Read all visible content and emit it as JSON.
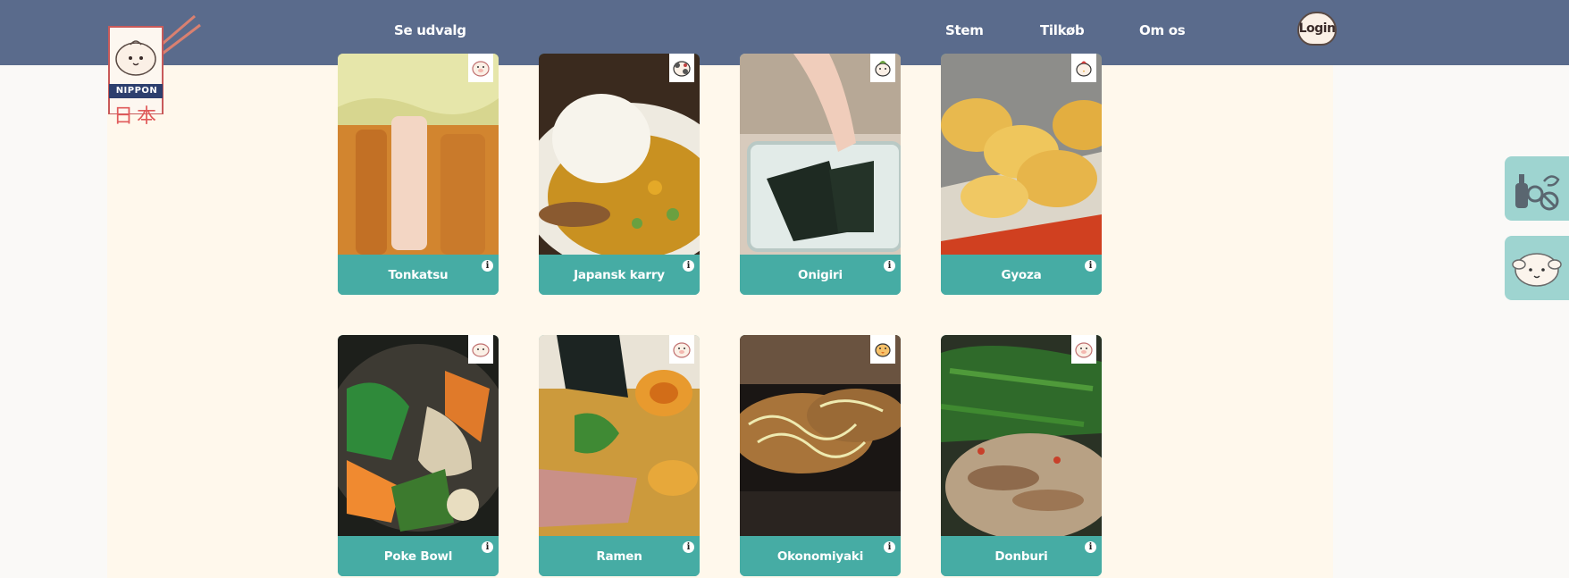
{
  "brand": {
    "logo_text": "NIPPON",
    "logo_kanji": "日本"
  },
  "nav": {
    "items": [
      {
        "label": "Se udvalg"
      },
      {
        "label": "Stem"
      },
      {
        "label": "Tilkøb"
      },
      {
        "label": "Om os"
      }
    ],
    "login_label": "Login"
  },
  "dishes": [
    {
      "name": "Tonkatsu",
      "badge_icon": "pig-icon"
    },
    {
      "name": "Japansk karry",
      "badge_icon": "cow-icon"
    },
    {
      "name": "Onigiri",
      "badge_icon": "vegetable-icon"
    },
    {
      "name": "Gyoza",
      "badge_icon": "chicken-icon"
    },
    {
      "name": "Poke Bowl",
      "badge_icon": "fish-icon"
    },
    {
      "name": "Ramen",
      "badge_icon": "pig-icon"
    },
    {
      "name": "Okonomiyaki",
      "badge_icon": "duck-icon"
    },
    {
      "name": "Donburi",
      "badge_icon": "pig-icon"
    }
  ],
  "side_tabs": [
    {
      "icon": "allergens-icon"
    },
    {
      "icon": "sheep-icon"
    }
  ],
  "colors": {
    "header": "#5a6b8c",
    "card_label": "#46aca4",
    "page_bg": "#fff8ec",
    "side_tab": "#9ed4d0"
  }
}
